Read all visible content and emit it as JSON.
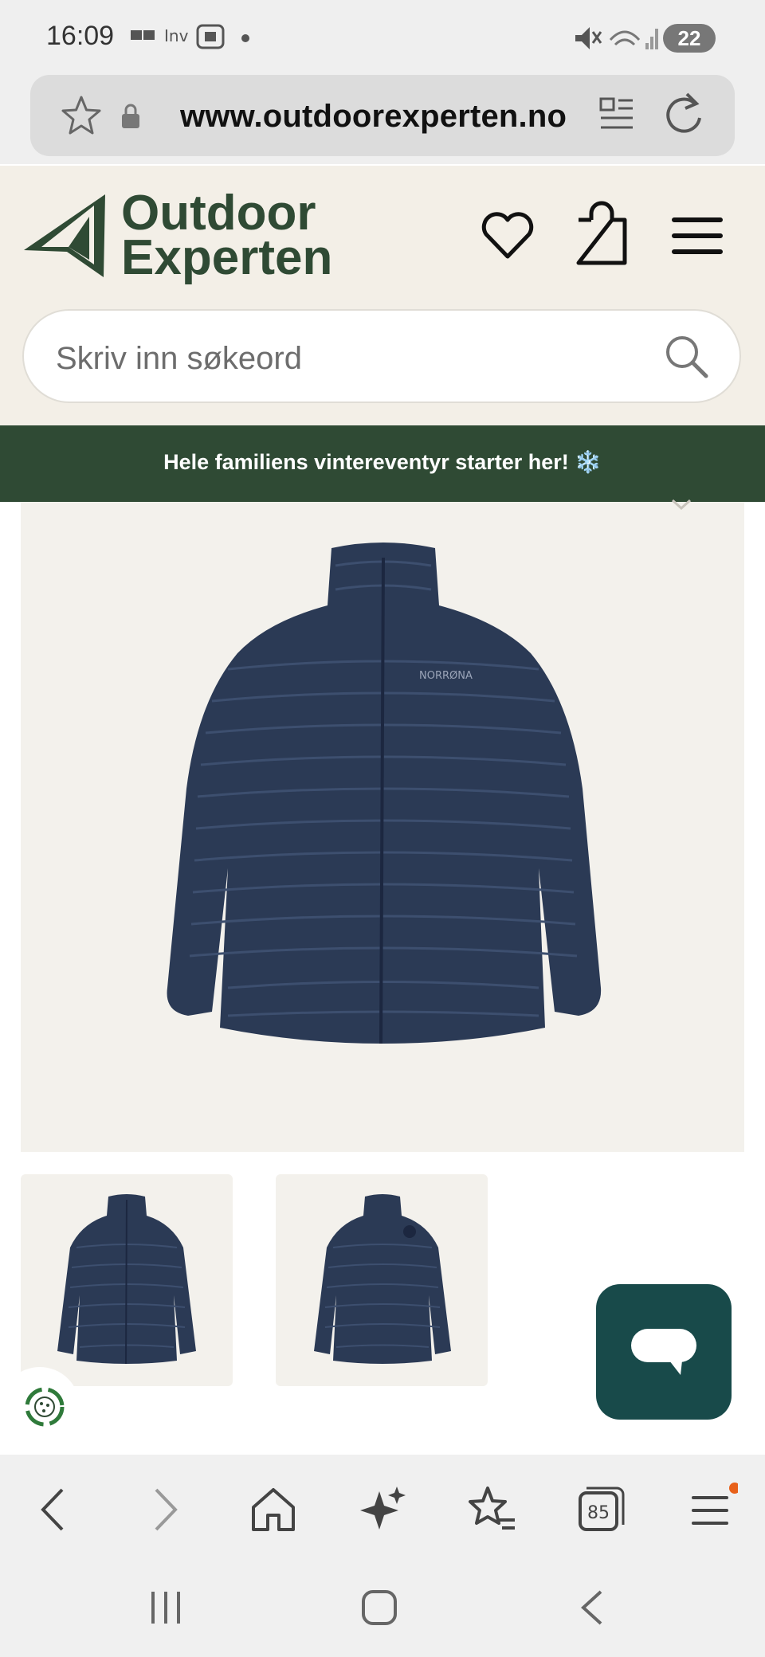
{
  "status_bar": {
    "time": "16:09",
    "battery": "22"
  },
  "browser": {
    "url": "www.outdoorexperten.no",
    "tab_count": "85"
  },
  "header": {
    "logo_line1": "Outdoor",
    "logo_line2": "Experten",
    "search_placeholder": "Skriv inn søkeord"
  },
  "banner": {
    "text": "Hele familiens vintereventyr starter her! ❄️"
  },
  "product": {
    "brand_mark": "NORRØNA",
    "thumbnails": [
      "front",
      "back"
    ]
  },
  "colors": {
    "brand_green": "#2f4a34",
    "header_bg": "#f3efe7",
    "jacket": "#2b3a55",
    "chat": "#184a4a"
  }
}
